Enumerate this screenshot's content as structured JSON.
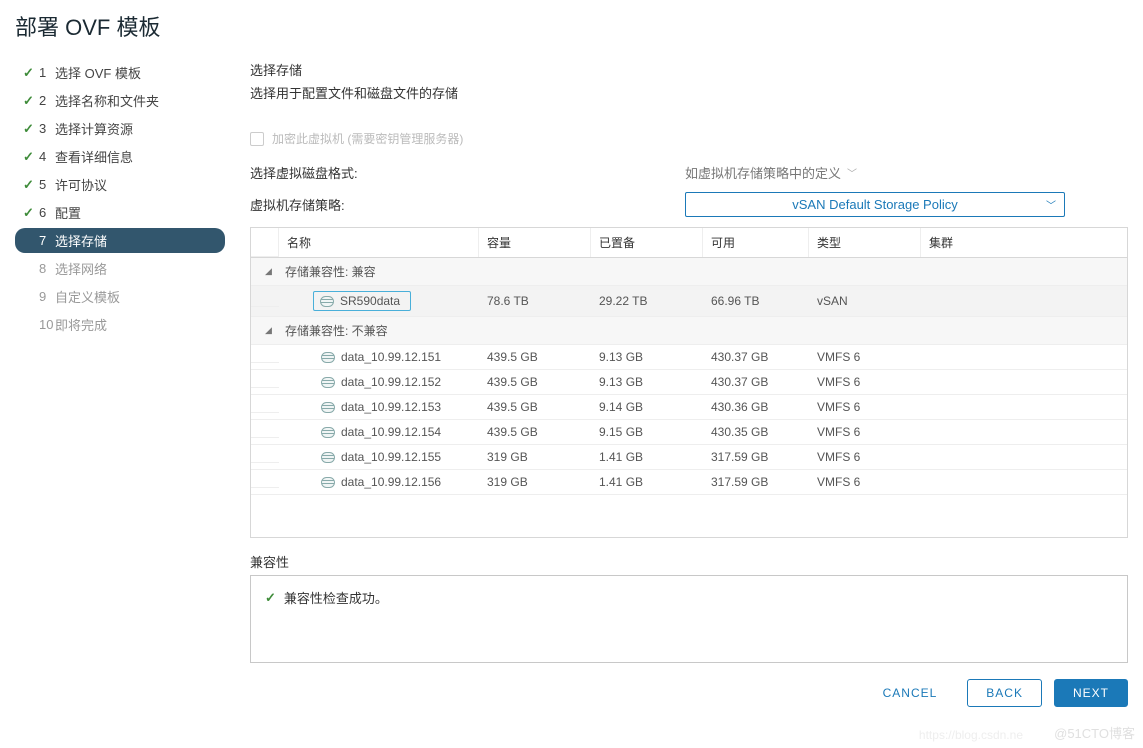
{
  "title": "部署 OVF 模板",
  "steps": [
    {
      "n": "1",
      "label": "选择 OVF 模板",
      "state": "done"
    },
    {
      "n": "2",
      "label": "选择名称和文件夹",
      "state": "done"
    },
    {
      "n": "3",
      "label": "选择计算资源",
      "state": "done"
    },
    {
      "n": "4",
      "label": "查看详细信息",
      "state": "done"
    },
    {
      "n": "5",
      "label": "许可协议",
      "state": "done"
    },
    {
      "n": "6",
      "label": "配置",
      "state": "done"
    },
    {
      "n": "7",
      "label": "选择存储",
      "state": "current"
    },
    {
      "n": "8",
      "label": "选择网络",
      "state": "pending"
    },
    {
      "n": "9",
      "label": "自定义模板",
      "state": "pending"
    },
    {
      "n": "10",
      "label": "即将完成",
      "state": "pending"
    }
  ],
  "section": {
    "heading": "选择存储",
    "sub": "选择用于配置文件和磁盘文件的存储"
  },
  "encrypt": {
    "label": "加密此虚拟机 (需要密钥管理服务器)"
  },
  "disk_format": {
    "label": "选择虚拟磁盘格式:",
    "value": "如虚拟机存储策略中的定义"
  },
  "storage_policy": {
    "label": "虚拟机存储策略:",
    "value": "vSAN Default Storage Policy"
  },
  "table": {
    "headers": {
      "name": "名称",
      "capacity": "容量",
      "provisioned": "已置备",
      "free": "可用",
      "type": "类型",
      "cluster": "集群"
    },
    "groups": [
      {
        "label": "存储兼容性: 兼容",
        "rows": [
          {
            "name": "SR590data",
            "capacity": "78.6 TB",
            "provisioned": "29.22 TB",
            "free": "66.96 TB",
            "type": "vSAN",
            "cluster": "",
            "selected": true
          }
        ]
      },
      {
        "label": "存储兼容性: 不兼容",
        "rows": [
          {
            "name": "data_10.99.12.151",
            "capacity": "439.5 GB",
            "provisioned": "9.13 GB",
            "free": "430.37 GB",
            "type": "VMFS 6",
            "cluster": ""
          },
          {
            "name": "data_10.99.12.152",
            "capacity": "439.5 GB",
            "provisioned": "9.13 GB",
            "free": "430.37 GB",
            "type": "VMFS 6",
            "cluster": ""
          },
          {
            "name": "data_10.99.12.153",
            "capacity": "439.5 GB",
            "provisioned": "9.14 GB",
            "free": "430.36 GB",
            "type": "VMFS 6",
            "cluster": ""
          },
          {
            "name": "data_10.99.12.154",
            "capacity": "439.5 GB",
            "provisioned": "9.15 GB",
            "free": "430.35 GB",
            "type": "VMFS 6",
            "cluster": ""
          },
          {
            "name": "data_10.99.12.155",
            "capacity": "319 GB",
            "provisioned": "1.41 GB",
            "free": "317.59 GB",
            "type": "VMFS 6",
            "cluster": ""
          },
          {
            "name": "data_10.99.12.156",
            "capacity": "319 GB",
            "provisioned": "1.41 GB",
            "free": "317.59 GB",
            "type": "VMFS 6",
            "cluster": ""
          }
        ]
      }
    ]
  },
  "compat": {
    "label": "兼容性",
    "message": "兼容性检查成功。"
  },
  "buttons": {
    "cancel": "CANCEL",
    "back": "BACK",
    "next": "NEXT"
  },
  "watermark": {
    "a": "@51CTO博客",
    "b": "https://blog.csdn.ne"
  }
}
